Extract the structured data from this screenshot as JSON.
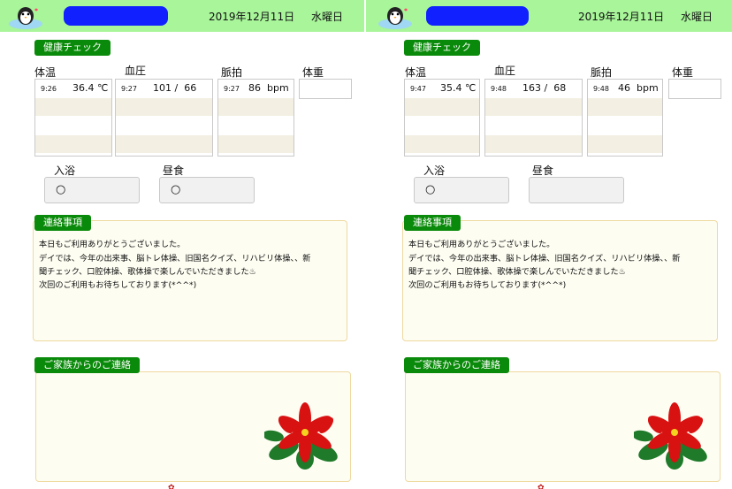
{
  "panels": [
    {
      "header": {
        "date": "2019年12月11日",
        "weekday": "水曜日"
      },
      "health_label": "健康チェック",
      "vitals": {
        "temp": {
          "title": "体温",
          "time": "9:26",
          "value": "36.4 ℃"
        },
        "bp": {
          "title": "血圧",
          "time": "9:27",
          "value": "101 /  66"
        },
        "pulse": {
          "title": "脈拍",
          "time": "9:27",
          "value": "86  bpm"
        },
        "weight": {
          "title": "体重"
        }
      },
      "bath": {
        "title": "入浴",
        "value": "○"
      },
      "lunch": {
        "title": "昼食",
        "value": "○"
      },
      "notes_label": "連絡事項",
      "notes": [
        "本日もご利用ありがとうございました。",
        "デイでは、今年の出来事、脳トレ体操、旧国名クイズ、リハビリ体操、、新",
        "聞チェック、口腔体操、歌体操で楽しんでいただきました♨",
        "次回のご利用もお待ちしております(*^^*)"
      ],
      "family_label": "ご家族からのご連絡"
    },
    {
      "header": {
        "date": "2019年12月11日",
        "weekday": "水曜日"
      },
      "health_label": "健康チェック",
      "vitals": {
        "temp": {
          "title": "体温",
          "time": "9:47",
          "value": "35.4 ℃"
        },
        "bp": {
          "title": "血圧",
          "time": "9:48",
          "value": "163 /  68"
        },
        "pulse": {
          "title": "脈拍",
          "time": "9:48",
          "value": "46  bpm"
        },
        "weight": {
          "title": "体重"
        }
      },
      "bath": {
        "title": "入浴",
        "value": "○"
      },
      "lunch": {
        "title": "昼食",
        "value": ""
      },
      "notes_label": "連絡事項",
      "notes": [
        "本日もご利用ありがとうございました。",
        "デイでは、今年の出来事、脳トレ体操、旧国名クイズ、リハビリ体操、、新",
        "聞チェック、口腔体操、歌体操で楽しんでいただきました♨",
        "次回のご利用もお待ちしております(*^^*)"
      ],
      "family_label": "ご家族からのご連絡"
    }
  ],
  "colors": {
    "header_bg": "#a8f59a",
    "label_bg": "#0a8a0a",
    "row_alt": "#f3efe2",
    "redaction": "#1020ff"
  },
  "icons": {
    "logo": "penguin-hot-spring-icon",
    "decoration": "poinsettia-icon",
    "footer": "flower-mark-icon"
  }
}
